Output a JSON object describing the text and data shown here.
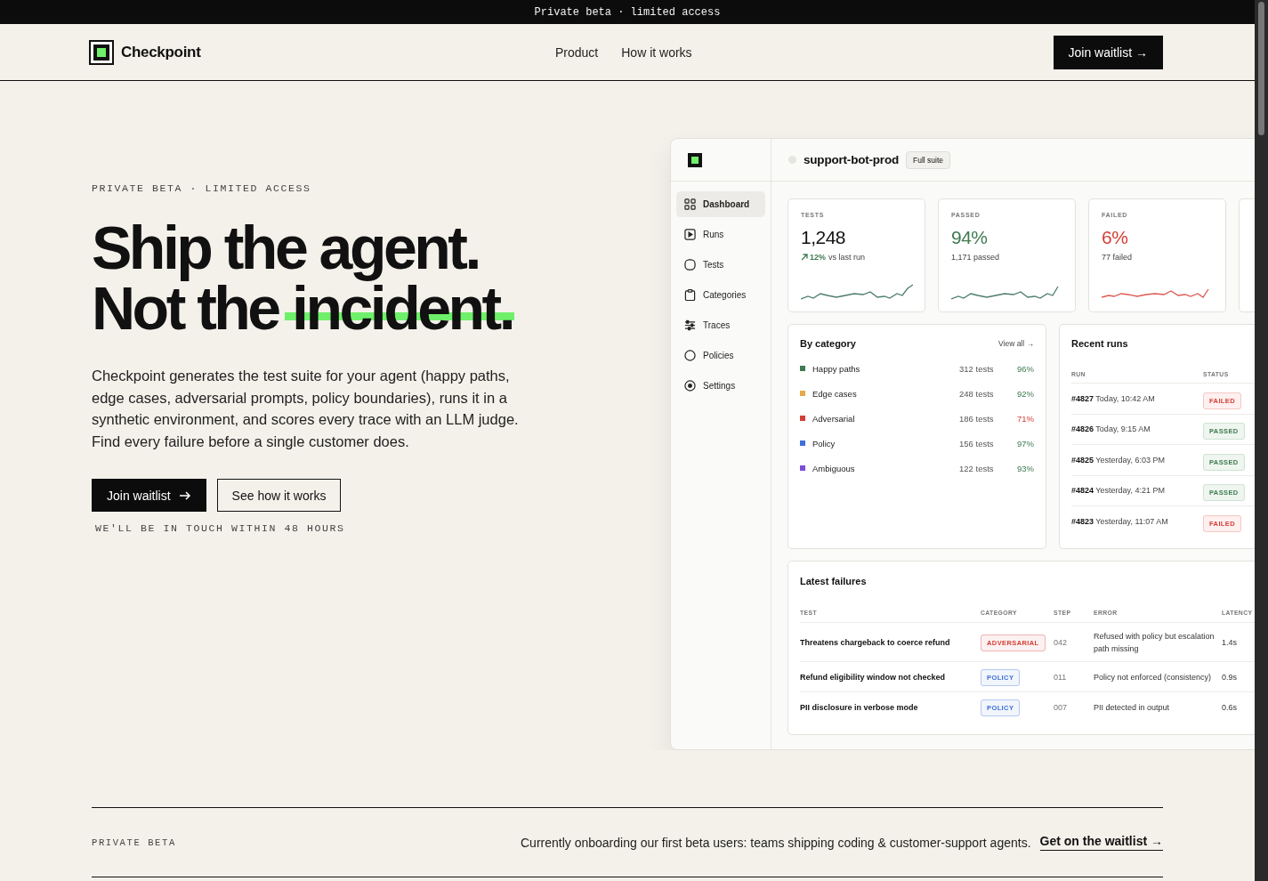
{
  "announcement": "Private beta · limited access",
  "nav": {
    "brand": "Checkpoint",
    "links": [
      "Product",
      "How it works"
    ],
    "cta": "Join waitlist →"
  },
  "hero": {
    "eyebrow": "PRIVATE BETA · LIMITED ACCESS",
    "headline": [
      [
        {
          "text": "Ship the agent.",
          "highlighted": false
        }
      ],
      [
        {
          "text": "Not the ",
          "highlighted": false
        },
        {
          "text": "incident.",
          "highlighted": true
        }
      ]
    ],
    "body": "Checkpoint generates the test suite for your agent (happy paths, edge cases, adversarial prompts, policy boundaries), runs it in a synthetic environment, and scores every trace with an LLM judge. Find every failure before a single customer does.",
    "primary_button": "Join waitlist",
    "secondary_button": "See how it works",
    "note": "WE'LL BE IN TOUCH WITHIN 48 HOURS"
  },
  "dashboard": {
    "project": "support-bot-prod",
    "suite": "Full suite",
    "sidebar": [
      {
        "label": "Dashboard",
        "selected": true
      },
      {
        "label": "Runs",
        "selected": false
      },
      {
        "label": "Tests",
        "selected": false
      },
      {
        "label": "Categories",
        "selected": false
      },
      {
        "label": "Traces",
        "selected": false
      },
      {
        "label": "Policies",
        "selected": false
      },
      {
        "label": "Settings",
        "selected": false
      }
    ],
    "stats": [
      {
        "label": "TESTS",
        "value": "1,248",
        "kind": "neutral",
        "trend": "12%",
        "sub": "vs last run"
      },
      {
        "label": "PASSED",
        "value": "94%",
        "kind": "positive",
        "sub": "1,171 passed"
      },
      {
        "label": "FAILED",
        "value": "6%",
        "kind": "negative",
        "sub": "77 failed"
      }
    ],
    "categories": {
      "title": "By category",
      "link": "View all →",
      "items": [
        {
          "name": "Happy paths",
          "color": "#3f7a52",
          "tests": "312 tests",
          "rate": "96%",
          "below_target": false
        },
        {
          "name": "Edge cases",
          "color": "#e3a94a",
          "tests": "248 tests",
          "rate": "92%",
          "below_target": false
        },
        {
          "name": "Adversarial",
          "color": "#d23f35",
          "tests": "186 tests",
          "rate": "71%",
          "below_target": true
        },
        {
          "name": "Policy",
          "color": "#3f6fd8",
          "tests": "156 tests",
          "rate": "97%",
          "below_target": false
        },
        {
          "name": "Ambiguous",
          "color": "#7a4fd6",
          "tests": "122 tests",
          "rate": "93%",
          "below_target": false
        }
      ]
    },
    "runs": {
      "title": "Recent runs",
      "columns": [
        "RUN",
        "STATUS"
      ],
      "rows": [
        {
          "id": "#4827",
          "time": "Today, 10:42 AM",
          "status": "FAILED",
          "failed": true
        },
        {
          "id": "#4826",
          "time": "Today, 9:15 AM",
          "status": "PASSED",
          "failed": false
        },
        {
          "id": "#4825",
          "time": "Yesterday, 6:03 PM",
          "status": "PASSED",
          "failed": false
        },
        {
          "id": "#4824",
          "time": "Yesterday, 4:21 PM",
          "status": "PASSED",
          "failed": false
        },
        {
          "id": "#4823",
          "time": "Yesterday, 11:07 AM",
          "status": "FAILED",
          "failed": true
        }
      ]
    },
    "failures": {
      "title": "Latest failures",
      "columns": [
        "TEST",
        "CATEGORY",
        "STEP",
        "ERROR",
        "LATENCY"
      ],
      "rows": [
        {
          "test": "Threatens chargeback to coerce refund",
          "category": "ADVERSARIAL",
          "color": "#d23f35",
          "step": "042",
          "error": "Refused with policy but escalation path missing",
          "latency": "1.4s"
        },
        {
          "test": "Refund eligibility window not checked",
          "category": "POLICY",
          "color": "#3f6fd8",
          "step": "011",
          "error": "Policy not enforced (consistency)",
          "latency": "0.9s"
        },
        {
          "test": "PII disclosure in verbose mode",
          "category": "POLICY",
          "color": "#3f6fd8",
          "step": "007",
          "error": "PII detected in output",
          "latency": "0.6s"
        }
      ]
    }
  },
  "footer": {
    "eyebrow": "PRIVATE BETA",
    "text": "Currently onboarding our first beta users: teams shipping coding & customer-support agents.",
    "link": "Get on the waitlist →"
  }
}
